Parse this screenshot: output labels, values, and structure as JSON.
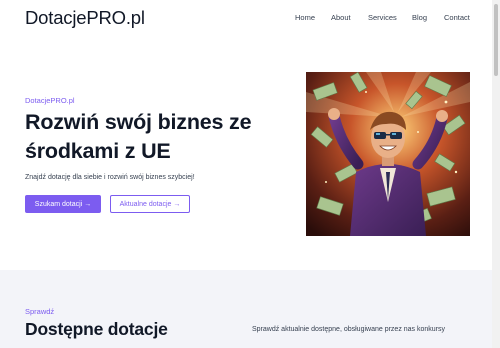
{
  "brand": {
    "logo": "DotacjePRO.pl"
  },
  "nav": {
    "items": [
      {
        "label": "Home"
      },
      {
        "label": "About"
      },
      {
        "label": "Services"
      },
      {
        "label": "Blog"
      },
      {
        "label": "Contact"
      }
    ]
  },
  "hero": {
    "eyebrow": "DotacjePRO.pl",
    "title": "Rozwiń swój biznes ze środkami z UE",
    "subtitle": "Znajdź dotację dla siebie i rozwiń swój biznes szybciej!",
    "primary_button": "Szukam dotacji →",
    "secondary_button": "Aktualne dotacje →"
  },
  "grants_section": {
    "eyebrow": "Sprawdź",
    "title": "Dostępne dotacje",
    "description": "Sprawdź aktualnie dostępne, obsługiwane przez nas konkursy"
  },
  "colors": {
    "accent": "#7c5cf0",
    "section_bg": "#f3f4f9",
    "text": "#111827"
  }
}
